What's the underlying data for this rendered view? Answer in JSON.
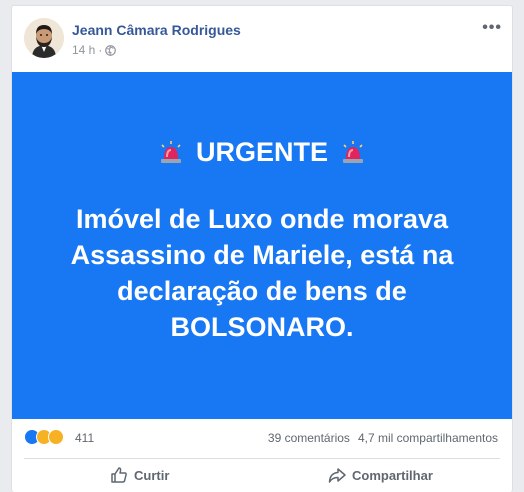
{
  "post": {
    "author": "Jeann Câmara Rodrigues",
    "time": "14 h",
    "separator": "·",
    "menu_label": "•••"
  },
  "image": {
    "urgent_label": "URGENTE",
    "headline": "Imóvel de Luxo onde morava Assassino de Mariele, está na declaração de bens de BOLSONARO.",
    "background_color": "#1877f2"
  },
  "reactions": {
    "icons": [
      "like-icon",
      "wow-icon",
      "haha-icon"
    ],
    "count": "411",
    "comments": "39 comentários",
    "shares": "4,7 mil compartilhamentos"
  },
  "actions": {
    "like_label": "Curtir",
    "share_label": "Compartilhar"
  }
}
